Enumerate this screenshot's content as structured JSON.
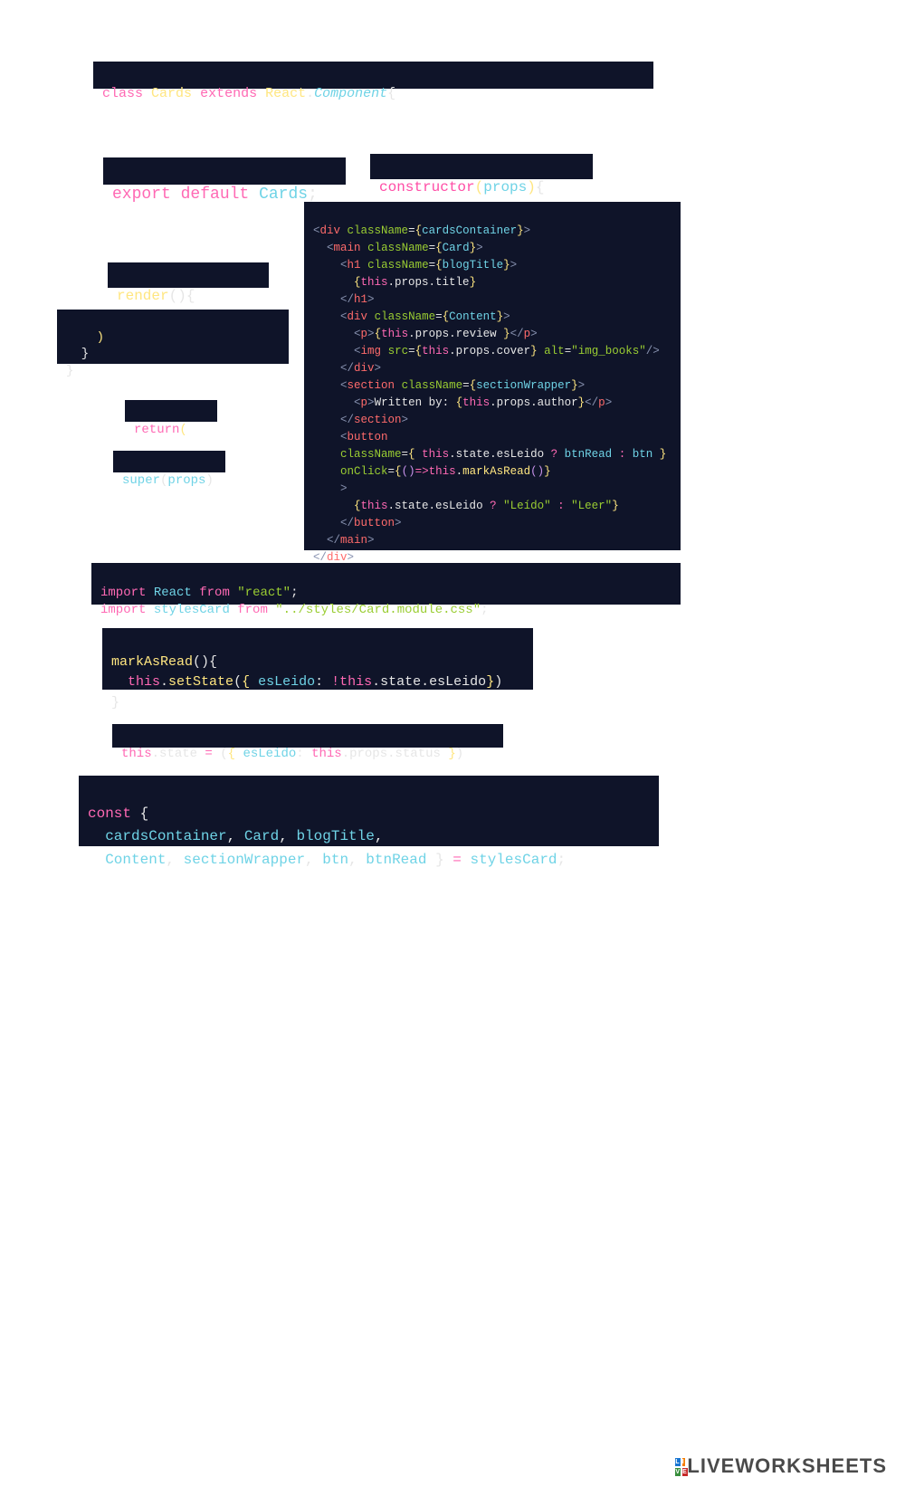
{
  "blocks": {
    "classDecl": "class Cards extends React.Component{",
    "exportDefault": "export default Cards;",
    "constructor": "constructor(props){",
    "render": "render(){",
    "closingBraces": "    )\n  }\n}",
    "returnStmt": "return(",
    "superProps": "super(props)",
    "jsxBlock": "<div className={cardsContainer}>\n  <main className={Card}>\n    <h1 className={blogTitle}>\n      {this.props.title}\n    </h1>\n    <div className={Content}>\n      <p>{this.props.review }</p>\n      <img src={this.props.cover} alt=\"img_books\"/>\n    </div>\n    <section className={sectionWrapper}>\n      <p>Written by: {this.props.author}</p>\n    </section>\n    <button\n    className={ this.state.esLeido ? btnRead : btn }\n    onClick={()=>this.markAsRead()}\n    >\n      {this.state.esLeido ? \"Leído\" : \"Leer\"}\n    </button>\n  </main>\n</div>",
    "imports": "import React from \"react\";\nimport stylesCard from \"../styles/Card.module.css\";",
    "markAsRead": "markAsRead(){\n  this.setState({ esLeido: !this.state.esLeido})\n}",
    "thisState": "this.state = ({ esLeido: this.props.status })",
    "constDestruct": "const {\n  cardsContainer, Card, blogTitle,\n  Content, sectionWrapper, btn, btnRead } = stylesCard;"
  },
  "footer": "LIVEWORKSHEETS"
}
